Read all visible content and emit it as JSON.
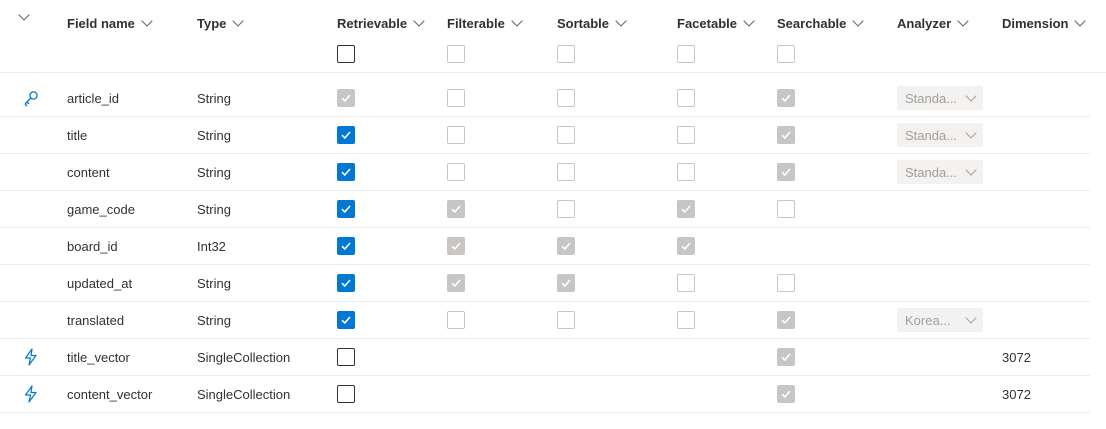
{
  "columns": {
    "field_name": "Field name",
    "type": "Type",
    "retrievable": "Retrievable",
    "filterable": "Filterable",
    "sortable": "Sortable",
    "facetable": "Facetable",
    "searchable": "Searchable",
    "analyzer": "Analyzer",
    "dimensions": "Dimension"
  },
  "header_checkboxes": {
    "retrievable": "unchecked",
    "filterable": "disabled-unchecked",
    "sortable": "disabled-unchecked",
    "facetable": "disabled-unchecked",
    "searchable": "disabled-unchecked"
  },
  "rows": [
    {
      "icon": "key-icon",
      "name": "article_id",
      "type": "String",
      "retrievable": "disabled-checked",
      "filterable": "disabled-unchecked",
      "sortable": "disabled-unchecked",
      "facetable": "disabled-unchecked",
      "searchable": "disabled-checked",
      "analyzer": "Standa...",
      "dimensions": ""
    },
    {
      "icon": "",
      "name": "title",
      "type": "String",
      "retrievable": "checked",
      "filterable": "disabled-unchecked",
      "sortable": "disabled-unchecked",
      "facetable": "disabled-unchecked",
      "searchable": "disabled-checked",
      "analyzer": "Standa...",
      "dimensions": ""
    },
    {
      "icon": "",
      "name": "content",
      "type": "String",
      "retrievable": "checked",
      "filterable": "disabled-unchecked",
      "sortable": "disabled-unchecked",
      "facetable": "disabled-unchecked",
      "searchable": "disabled-checked",
      "analyzer": "Standa...",
      "dimensions": ""
    },
    {
      "icon": "",
      "name": "game_code",
      "type": "String",
      "retrievable": "checked",
      "filterable": "disabled-checked",
      "sortable": "disabled-unchecked",
      "facetable": "disabled-checked",
      "searchable": "disabled-unchecked",
      "analyzer": "",
      "dimensions": ""
    },
    {
      "icon": "",
      "name": "board_id",
      "type": "Int32",
      "retrievable": "checked",
      "filterable": "disabled-checked",
      "sortable": "disabled-checked",
      "facetable": "disabled-checked",
      "searchable": "none",
      "analyzer": "",
      "dimensions": ""
    },
    {
      "icon": "",
      "name": "updated_at",
      "type": "String",
      "retrievable": "checked",
      "filterable": "disabled-checked",
      "sortable": "disabled-checked",
      "facetable": "disabled-unchecked",
      "searchable": "disabled-unchecked",
      "analyzer": "",
      "dimensions": ""
    },
    {
      "icon": "",
      "name": "translated",
      "type": "String",
      "retrievable": "checked",
      "filterable": "disabled-unchecked",
      "sortable": "disabled-unchecked",
      "facetable": "disabled-unchecked",
      "searchable": "disabled-checked",
      "analyzer": "Korea...",
      "dimensions": ""
    },
    {
      "icon": "lightning-icon",
      "name": "title_vector",
      "type": "SingleCollection",
      "retrievable": "unchecked",
      "filterable": "none",
      "sortable": "none",
      "facetable": "none",
      "searchable": "disabled-checked",
      "analyzer": "",
      "dimensions": "3072"
    },
    {
      "icon": "lightning-icon",
      "name": "content_vector",
      "type": "SingleCollection",
      "retrievable": "unchecked",
      "filterable": "none",
      "sortable": "none",
      "facetable": "none",
      "searchable": "disabled-checked",
      "analyzer": "",
      "dimensions": "3072"
    }
  ],
  "colors": {
    "accent": "#0078d4",
    "disabled": "#c8c6c4",
    "border": "#edebe9",
    "text": "#323130",
    "icon": "#0078d4"
  }
}
